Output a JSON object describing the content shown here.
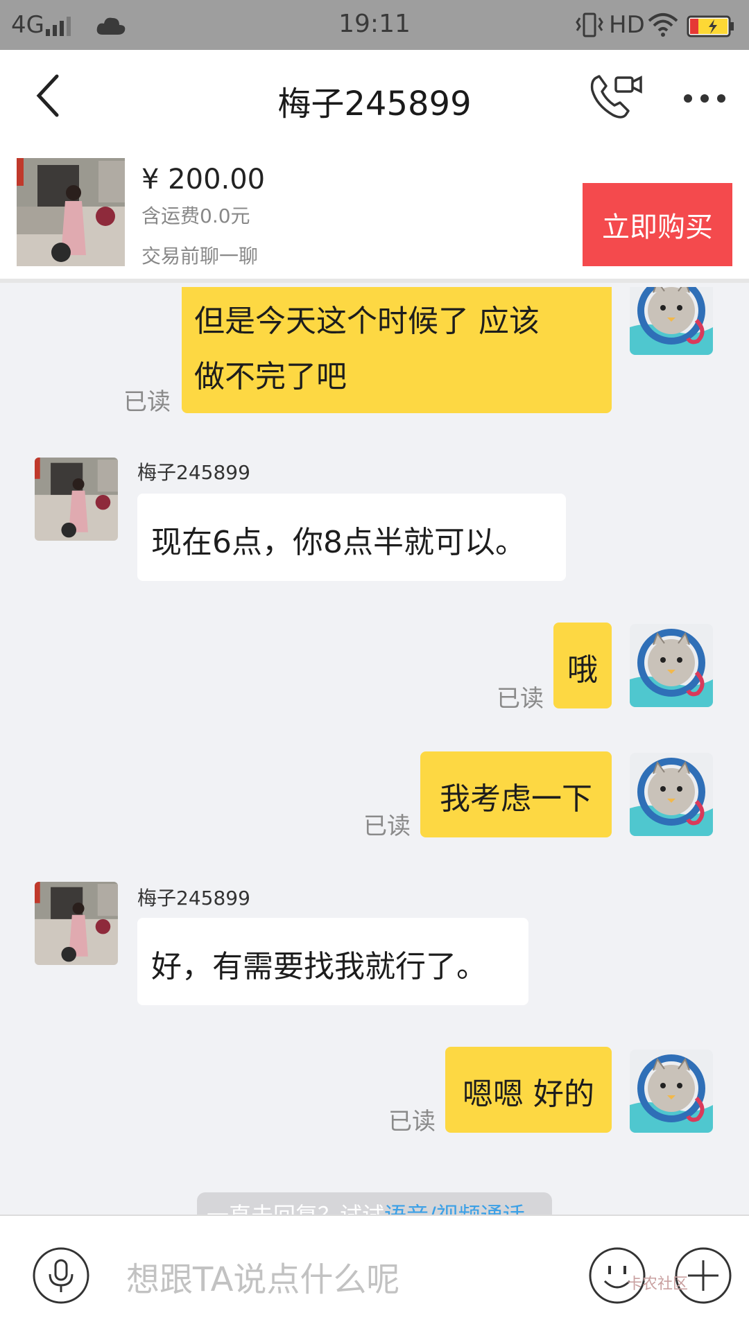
{
  "status_bar": {
    "network": "4G",
    "time": "19:11",
    "hd": "HD"
  },
  "header": {
    "title": "梅子245899"
  },
  "product": {
    "price": "¥ 200.00",
    "shipping": "含运费0.0元",
    "chat_hint": "交易前聊一聊",
    "buy_label": "立即购买"
  },
  "messages": [
    {
      "id": "m1",
      "from": "me",
      "lines": [
        "但是今天这个时候了 应该",
        "做不完了吧"
      ],
      "read": "已读"
    },
    {
      "id": "m2",
      "from": "seller",
      "sender": "梅子245899",
      "text": "现在6点，你8点半就可以。"
    },
    {
      "id": "m3",
      "from": "me",
      "text": "哦",
      "read": "已读"
    },
    {
      "id": "m4",
      "from": "me",
      "text": "我考虑一下",
      "read": "已读"
    },
    {
      "id": "m5",
      "from": "seller",
      "sender": "梅子245899",
      "text": "好，有需要找我就行了。"
    },
    {
      "id": "m6",
      "from": "me",
      "text": "嗯嗯 好的",
      "read": "已读"
    }
  ],
  "call_hint": {
    "text": "一直未回复？试试",
    "link": "语音/视频通话"
  },
  "input": {
    "placeholder": "想跟TA说点什么呢"
  },
  "watermark": "卡农社区",
  "colors": {
    "my_bubble": "#fdd843",
    "buy_button": "#f44a4d",
    "link": "#3ba0e6"
  }
}
